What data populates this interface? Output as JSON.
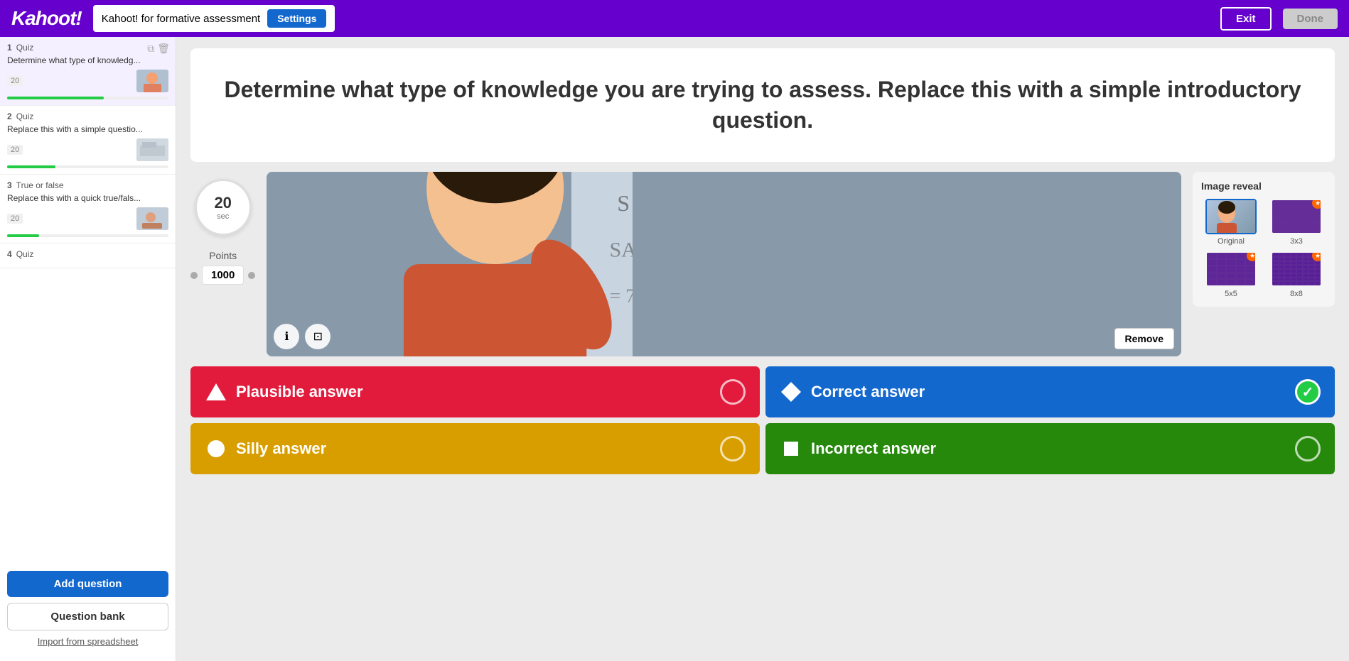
{
  "header": {
    "logo": "Kahoot!",
    "title": "Kahoot! for formative assessment",
    "settings_label": "Settings",
    "exit_label": "Exit",
    "done_label": "Done"
  },
  "sidebar": {
    "questions": [
      {
        "number": "1",
        "type": "Quiz",
        "title": "Determine what type of knowledg...",
        "time": "20",
        "progress_width": "60%",
        "active": true
      },
      {
        "number": "2",
        "type": "Quiz",
        "title": "Replace this with a simple questio...",
        "time": "20",
        "progress_width": "30%",
        "active": false
      },
      {
        "number": "3",
        "type": "True or false",
        "title": "Replace this with a quick true/fals...",
        "time": "20",
        "progress_width": "20%",
        "active": false
      },
      {
        "number": "4",
        "type": "Quiz",
        "title": "",
        "time": "",
        "progress_width": "0%",
        "active": false
      }
    ],
    "add_question_label": "Add question",
    "question_bank_label": "Question bank",
    "import_label": "Import from spreadsheet"
  },
  "question": {
    "text": "Determine what type of knowledge you are trying to assess. Replace this with a simple introductory question.",
    "time_value": "20",
    "time_unit": "sec",
    "points_label": "Points",
    "points_value": "1000",
    "remove_label": "Remove"
  },
  "image_reveal": {
    "title": "Image reveal",
    "options": [
      {
        "label": "Original",
        "grid": "none",
        "selected": true,
        "badge": false
      },
      {
        "label": "3x3",
        "grid": "g3",
        "selected": false,
        "badge": true
      },
      {
        "label": "5x5",
        "grid": "g5",
        "selected": false,
        "badge": true
      },
      {
        "label": "8x8",
        "grid": "g8",
        "selected": false,
        "badge": true
      }
    ]
  },
  "answers": [
    {
      "shape": "triangle",
      "text": "Plausible answer",
      "color": "red",
      "correct": false
    },
    {
      "shape": "diamond",
      "text": "Correct answer",
      "color": "blue",
      "correct": true
    },
    {
      "shape": "circle",
      "text": "Silly answer",
      "color": "gold",
      "correct": false
    },
    {
      "shape": "square",
      "text": "Incorrect answer",
      "color": "green",
      "correct": false
    }
  ]
}
